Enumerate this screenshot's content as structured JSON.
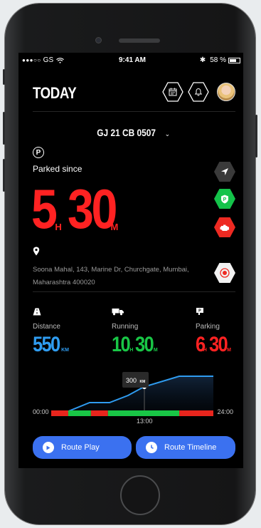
{
  "status_bar": {
    "carrier": "GS",
    "time": "9:41 AM",
    "battery": "58 %"
  },
  "header": {
    "title": "TODAY"
  },
  "vehicle": {
    "plate": "GJ 21 CB 0507"
  },
  "parked": {
    "label": "Parked since",
    "hours": "5",
    "hours_unit": "H",
    "minutes": "30",
    "minutes_unit": "M"
  },
  "address": {
    "line1": "Soona Mahal, 143, Marine Dr, Churchgate, Mumbai,",
    "line2": "Maharashtra 400020"
  },
  "stats": {
    "distance": {
      "label": "Distance",
      "value": "550",
      "unit": "KM",
      "color": "#2f9cf0"
    },
    "running": {
      "label": "Running",
      "hours": "10",
      "hours_unit": "H",
      "minutes": "30",
      "minutes_unit": "M",
      "color": "#19c646"
    },
    "parking": {
      "label": "Parking",
      "hours": "6",
      "hours_unit": "H",
      "minutes": "30",
      "minutes_unit": "M",
      "color": "#ff2222"
    }
  },
  "timeline_chart": {
    "start_label": "00:00",
    "end_label": "24:00",
    "marker_label": "13:00",
    "tooltip_value": "300",
    "tooltip_unit": "KM",
    "segments": [
      {
        "state": "parking",
        "from": 0,
        "to": 0.105,
        "color": "#e8251d"
      },
      {
        "state": "running",
        "from": 0.105,
        "to": 0.245,
        "color": "#19c646"
      },
      {
        "state": "parking",
        "from": 0.245,
        "to": 0.35,
        "color": "#e8251d"
      },
      {
        "state": "running",
        "from": 0.35,
        "to": 0.79,
        "color": "#19c646"
      },
      {
        "state": "parking",
        "from": 0.79,
        "to": 1.0,
        "color": "#e8251d"
      }
    ]
  },
  "actions": {
    "route_play": "Route Play",
    "route_timeline": "Route Timeline"
  },
  "colors": {
    "accent": "#3b71f0",
    "running": "#19c646",
    "parking": "#ff2222",
    "distance": "#2f9cf0"
  }
}
